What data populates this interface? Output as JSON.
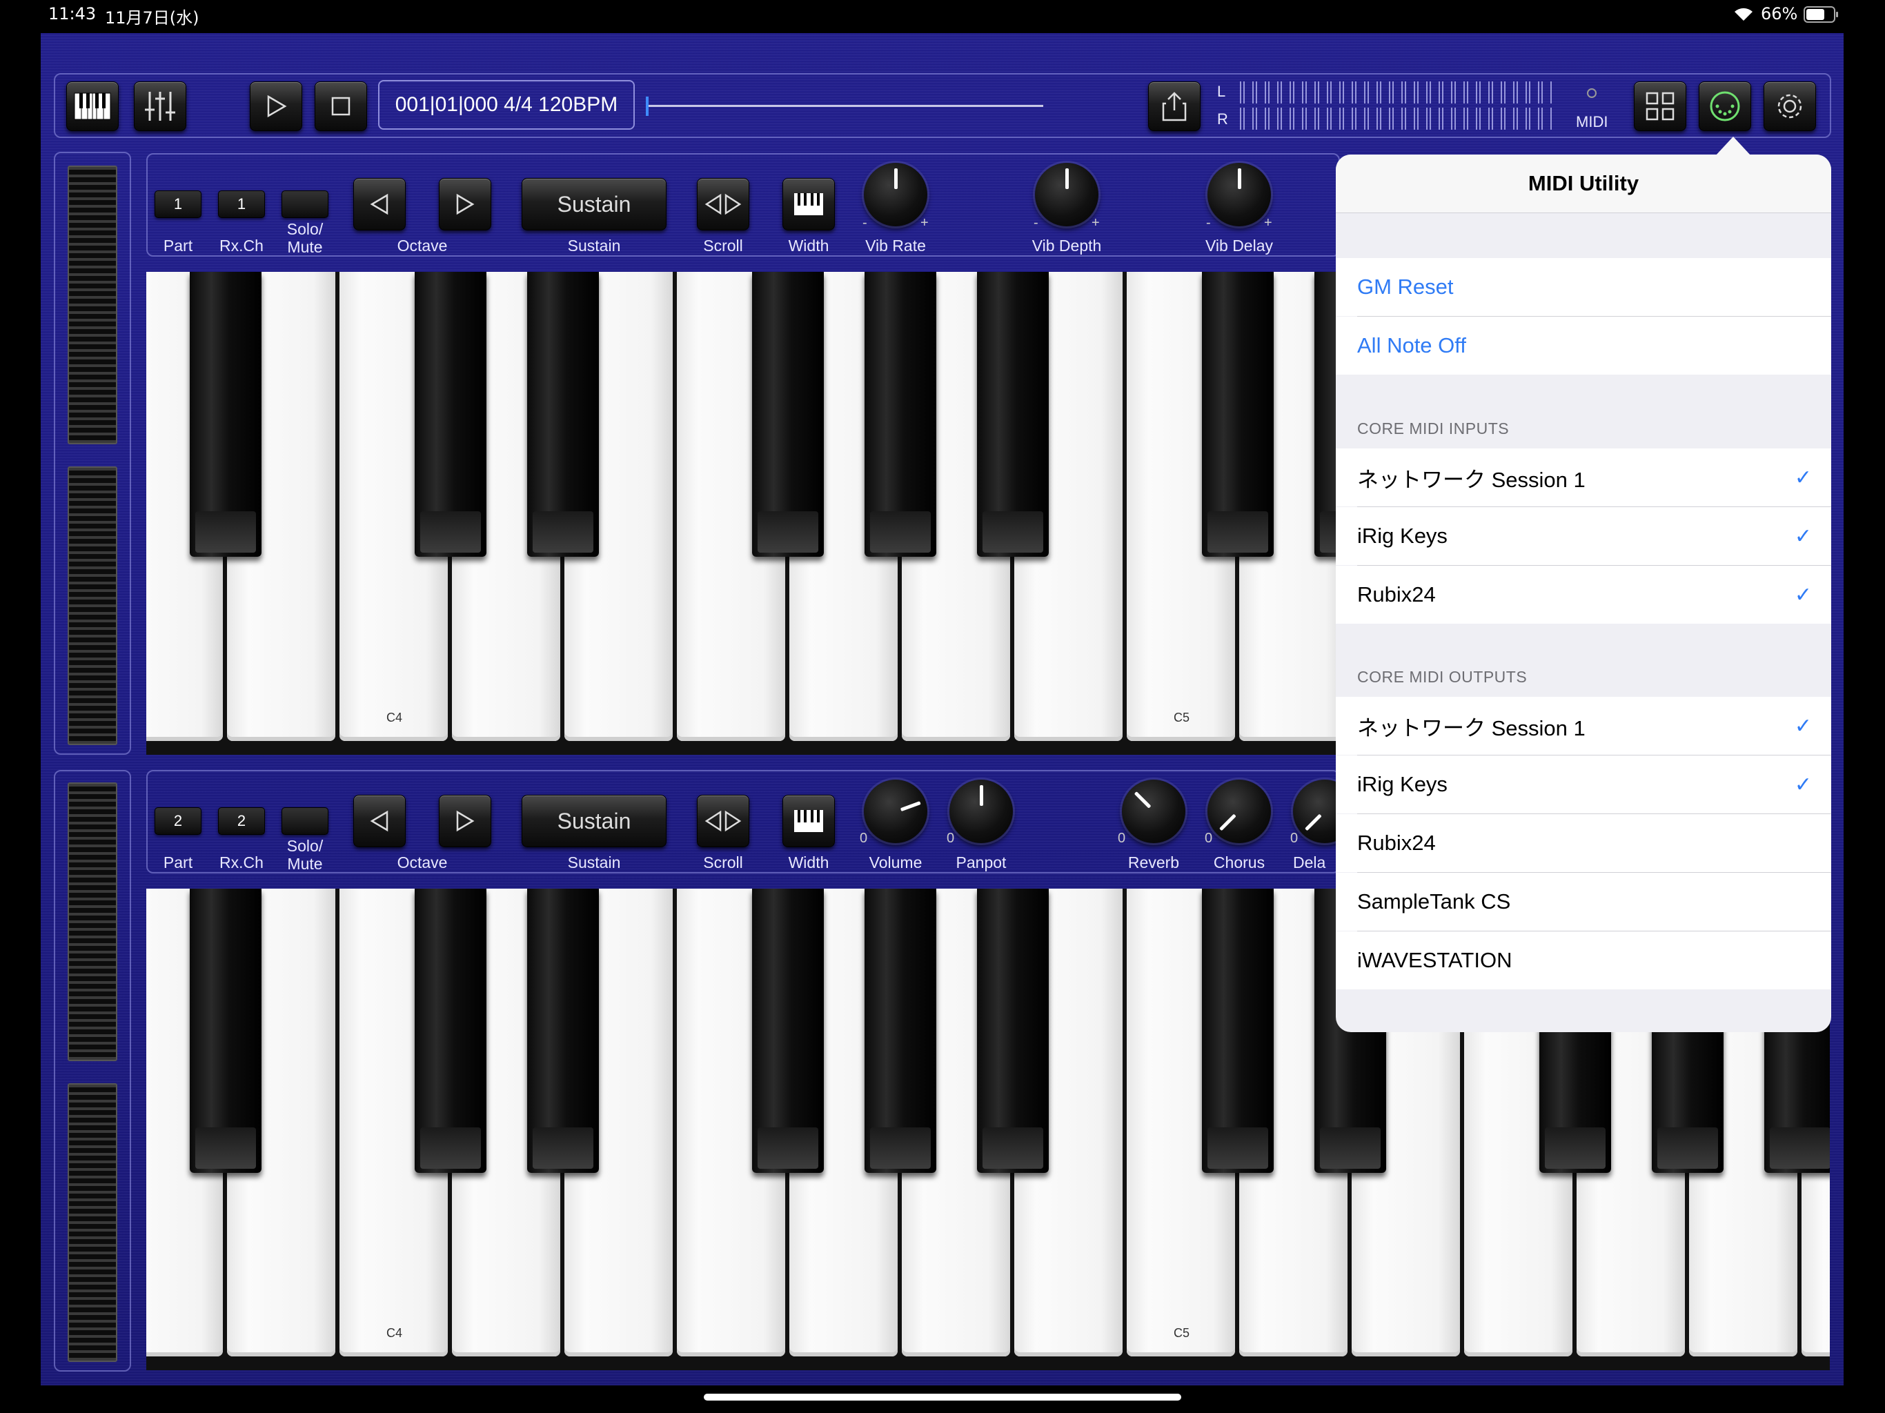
{
  "status_bar": {
    "time": "11:43",
    "date": "11月7日(水)",
    "battery": "66%"
  },
  "toolbar": {
    "position": "001|01|000 4/4 120BPM",
    "meter_l": "L",
    "meter_r": "R",
    "midi_label": "MIDI"
  },
  "part1": {
    "part_value": "1",
    "rxch_value": "1",
    "sustain_button": "Sustain",
    "labels": {
      "part": "Part",
      "rxch": "Rx.Ch",
      "solo": "Solo/",
      "mute": "Mute",
      "octave": "Octave",
      "sustain": "Sustain",
      "scroll": "Scroll",
      "width": "Width",
      "vib_rate": "Vib Rate",
      "vib_depth": "Vib Depth",
      "vib_delay": "Vib Delay"
    },
    "knob_minus": "-",
    "knob_plus": "+",
    "key_c4": "C4",
    "key_c5": "C5"
  },
  "part2": {
    "part_value": "2",
    "rxch_value": "2",
    "sustain_button": "Sustain",
    "labels": {
      "part": "Part",
      "rxch": "Rx.Ch",
      "solo": "Solo/",
      "mute": "Mute",
      "octave": "Octave",
      "sustain": "Sustain",
      "scroll": "Scroll",
      "width": "Width",
      "volume": "Volume",
      "panpot": "Panpot",
      "reverb": "Reverb",
      "chorus": "Chorus",
      "delay": "Dela"
    },
    "knob_zero": "0",
    "key_c4": "C4",
    "key_c5": "C5"
  },
  "midi_utility": {
    "title": "MIDI Utility",
    "actions": [
      "GM Reset",
      "All Note Off"
    ],
    "inputs_header": "CORE MIDI INPUTS",
    "inputs": [
      {
        "name": "ネットワーク Session 1",
        "checked": true
      },
      {
        "name": "iRig Keys",
        "checked": true
      },
      {
        "name": "Rubix24",
        "checked": true
      }
    ],
    "outputs_header": "CORE MIDI OUTPUTS",
    "outputs": [
      {
        "name": "ネットワーク Session 1",
        "checked": true
      },
      {
        "name": "iRig Keys",
        "checked": true
      },
      {
        "name": "Rubix24",
        "checked": false
      },
      {
        "name": "SampleTank CS",
        "checked": false
      },
      {
        "name": "iWAVESTATION",
        "checked": false
      }
    ],
    "check_mark": "✓"
  },
  "colors": {
    "accent": "#2f7bf5",
    "background": "#1e1c86",
    "popover": "#efeff4"
  }
}
